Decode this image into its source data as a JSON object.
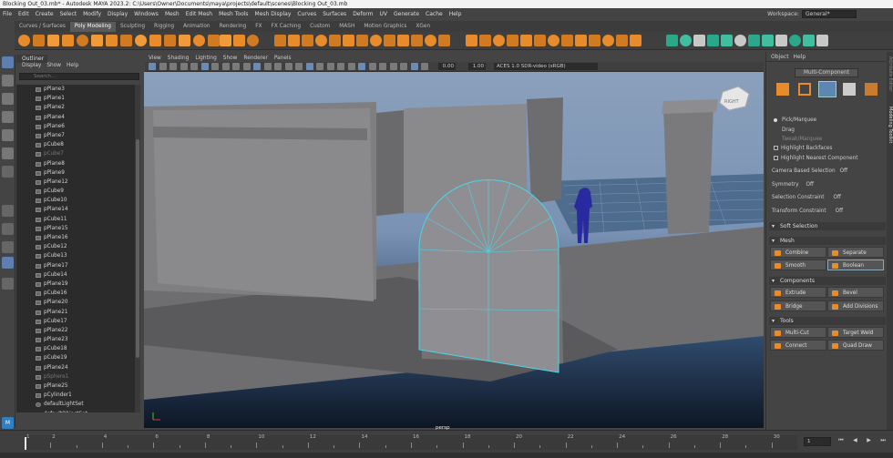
{
  "window_title": "Blocking Out_03.mb* - Autodesk MAYA 2023.2: C:\\Users\\Owner\\Documents\\maya\\projects\\default\\scenes\\Blocking Out_03.mb",
  "menus": [
    "File",
    "Edit",
    "Create",
    "Select",
    "Modify",
    "Display",
    "Windows",
    "Mesh",
    "Edit Mesh",
    "Mesh Tools",
    "Mesh Display",
    "Curves",
    "Surfaces",
    "Deform",
    "UV",
    "Generate",
    "Cache",
    "Help"
  ],
  "workspace": {
    "label": "Workspace:",
    "value": "General*"
  },
  "shelf_tabs": [
    "Curves / Surfaces",
    "Poly Modeling",
    "Sculpting",
    "Rigging",
    "Animation",
    "Rendering",
    "FX",
    "FX Caching",
    "Custom",
    "MASH",
    "Motion Graphics",
    "XGen"
  ],
  "shelf_active": "Poly Modeling",
  "outliner": {
    "title": "Outliner",
    "menu": [
      "Display",
      "Show",
      "Help"
    ],
    "search_placeholder": "Search...",
    "items": [
      {
        "name": "pPlane3",
        "hidden": false
      },
      {
        "name": "pPlane1",
        "hidden": false
      },
      {
        "name": "pPlane2",
        "hidden": false
      },
      {
        "name": "pPlane4",
        "hidden": false
      },
      {
        "name": "pPlane6",
        "hidden": false
      },
      {
        "name": "pPlane7",
        "hidden": false
      },
      {
        "name": "pCube8",
        "hidden": false
      },
      {
        "name": "pCube7",
        "hidden": true
      },
      {
        "name": "pPlane8",
        "hidden": false
      },
      {
        "name": "pPlane9",
        "hidden": false
      },
      {
        "name": "pPlane12",
        "hidden": false
      },
      {
        "name": "pCube9",
        "hidden": false
      },
      {
        "name": "pCube10",
        "hidden": false
      },
      {
        "name": "pPlane14",
        "hidden": false
      },
      {
        "name": "pCube11",
        "hidden": false
      },
      {
        "name": "pPlane15",
        "hidden": false
      },
      {
        "name": "pPlane16",
        "hidden": false
      },
      {
        "name": "pCube12",
        "hidden": false
      },
      {
        "name": "pCube13",
        "hidden": false
      },
      {
        "name": "pPlane17",
        "hidden": false
      },
      {
        "name": "pCube14",
        "hidden": false
      },
      {
        "name": "pPlane19",
        "hidden": false
      },
      {
        "name": "pCube16",
        "hidden": false
      },
      {
        "name": "pPlane20",
        "hidden": false
      },
      {
        "name": "pPlane21",
        "hidden": false
      },
      {
        "name": "pCube17",
        "hidden": false
      },
      {
        "name": "pPlane22",
        "hidden": false
      },
      {
        "name": "pPlane23",
        "hidden": false
      },
      {
        "name": "pCube18",
        "hidden": false
      },
      {
        "name": "pCube19",
        "hidden": false
      },
      {
        "name": "pPlane24",
        "hidden": false
      },
      {
        "name": "pSphere1",
        "hidden": true
      },
      {
        "name": "pPlane25",
        "hidden": false
      },
      {
        "name": "pCylinder1",
        "hidden": false
      },
      {
        "name": "defaultLightSet",
        "hidden": false
      },
      {
        "name": "defaultObjectSet",
        "hidden": false
      }
    ]
  },
  "viewport": {
    "menu": [
      "View",
      "Shading",
      "Lighting",
      "Show",
      "Renderer",
      "Panels"
    ],
    "field1": "0.00",
    "field2": "1.00",
    "colorspace": "ACES 1.0 SDR-video (sRGB)",
    "camera": "persp",
    "viewcube_label": "RIGHT"
  },
  "right_panel": {
    "tabs": [
      "Object",
      "Help"
    ],
    "title": "Multi-Component",
    "modes": [
      {
        "label": "Pick/Marquee",
        "kind": "radio",
        "on": true
      },
      {
        "label": "Drag",
        "kind": "radio",
        "on": false
      },
      {
        "label": "Tweak/Marquee",
        "kind": "radio",
        "on": false
      }
    ],
    "checks": [
      {
        "label": "Highlight Backfaces",
        "on": true
      },
      {
        "label": "Highlight Nearest Component",
        "on": true
      }
    ],
    "camera_based_selection": {
      "label": "Camera Based Selection",
      "value": "Off"
    },
    "symmetry": {
      "label": "Symmetry",
      "value": "Off"
    },
    "selection_constraint": {
      "label": "Selection Constraint",
      "value": "Off"
    },
    "transform_constraint": {
      "label": "Transform Constraint",
      "value": "Off"
    },
    "soft_selection": "Soft Selection",
    "sections": {
      "mesh": {
        "title": "Mesh",
        "buttons": [
          "Combine",
          "Separate",
          "Smooth",
          "Boolean"
        ]
      },
      "components": {
        "title": "Components",
        "buttons": [
          "Extrude",
          "Bevel",
          "Bridge",
          "Add Divisions"
        ]
      },
      "tools": {
        "title": "Tools",
        "buttons": [
          "Multi-Cut",
          "Target Weld",
          "Connect",
          "Quad Draw"
        ]
      }
    },
    "side_tabs": [
      "Attribute Editor",
      "Modeling Toolkit"
    ]
  },
  "timeline": {
    "ticks": [
      "1",
      "2",
      "4",
      "6",
      "8",
      "10",
      "12",
      "14",
      "16",
      "18",
      "20",
      "22",
      "24",
      "26",
      "28",
      "30"
    ],
    "current_frame": "1"
  },
  "colors": {
    "accent": "#e88b2a",
    "selection": "#4cd4e8",
    "panel": "#444444",
    "list_bg": "#2b2b2b"
  }
}
